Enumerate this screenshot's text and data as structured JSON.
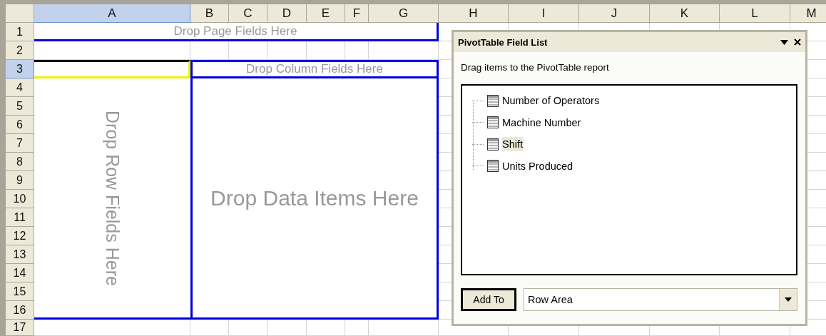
{
  "sheet": {
    "columns": [
      {
        "label": "A",
        "selected": true
      },
      {
        "label": "B",
        "selected": false
      },
      {
        "label": "C",
        "selected": false
      },
      {
        "label": "D",
        "selected": false
      },
      {
        "label": "E",
        "selected": false
      },
      {
        "label": "F",
        "selected": false
      },
      {
        "label": "G",
        "selected": false
      },
      {
        "label": "H",
        "selected": false
      },
      {
        "label": "I",
        "selected": false
      },
      {
        "label": "J",
        "selected": false
      },
      {
        "label": "K",
        "selected": false
      },
      {
        "label": "L",
        "selected": false
      },
      {
        "label": "M",
        "selected": false
      }
    ],
    "rows": [
      {
        "label": "1",
        "selected": false
      },
      {
        "label": "2",
        "selected": false
      },
      {
        "label": "3",
        "selected": true
      },
      {
        "label": "4",
        "selected": false
      },
      {
        "label": "5",
        "selected": false
      },
      {
        "label": "6",
        "selected": false
      },
      {
        "label": "7",
        "selected": false
      },
      {
        "label": "8",
        "selected": false
      },
      {
        "label": "9",
        "selected": false
      },
      {
        "label": "10",
        "selected": false
      },
      {
        "label": "11",
        "selected": false
      },
      {
        "label": "12",
        "selected": false
      },
      {
        "label": "13",
        "selected": false
      },
      {
        "label": "14",
        "selected": false
      },
      {
        "label": "15",
        "selected": false
      },
      {
        "label": "16",
        "selected": false
      },
      {
        "label": "17",
        "selected": false
      }
    ]
  },
  "pivot": {
    "page_area": "Drop Page Fields Here",
    "column_area": "Drop Column Fields Here",
    "row_area": "Drop Row Fields Here",
    "data_area": "Drop Data Items Here"
  },
  "field_list": {
    "title": "PivotTable Field List",
    "instruction": "Drag items to the PivotTable report",
    "fields": [
      {
        "name": "Number of Operators",
        "selected": false
      },
      {
        "name": "Machine Number",
        "selected": false
      },
      {
        "name": "Shift",
        "selected": true
      },
      {
        "name": "Units Produced",
        "selected": false
      }
    ],
    "add_button": "Add To",
    "area_select": {
      "value": "Row Area"
    }
  }
}
